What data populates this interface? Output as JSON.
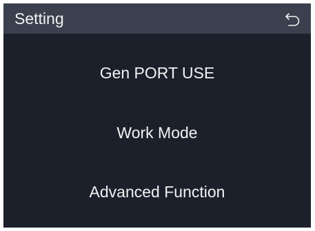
{
  "header": {
    "title": "Setting",
    "back_icon": "back-arrow-icon"
  },
  "menu": {
    "items": [
      {
        "label": "Gen PORT USE"
      },
      {
        "label": "Work Mode"
      },
      {
        "label": "Advanced Function"
      }
    ]
  },
  "colors": {
    "background": "#1b202b",
    "header": "#3a404d",
    "text": "#f2f2f2"
  }
}
